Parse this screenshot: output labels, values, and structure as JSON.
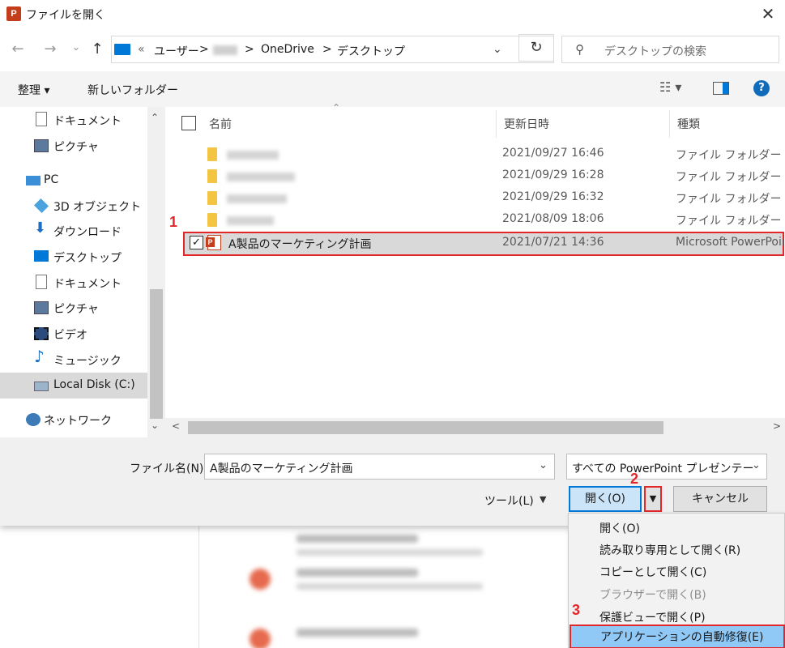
{
  "window": {
    "app_icon": "P",
    "title": "ファイルを開く",
    "close": "✕"
  },
  "nav": {
    "back": "←",
    "forward": "→",
    "recent": "⌄",
    "up": "↑",
    "address": {
      "sep_start": "«",
      "parts": [
        "ユーザー",
        "OneDrive",
        "デスクトップ"
      ],
      "sep": ">"
    },
    "refresh": "↻",
    "search_placeholder": "デスクトップの検索"
  },
  "toolbar": {
    "organize": "整理 ▾",
    "new_folder": "新しいフォルダー",
    "view": "☷ ▾",
    "help": "?"
  },
  "sidebar": {
    "items": [
      {
        "label": "ドキュメント",
        "icon": "document-icon"
      },
      {
        "label": "ピクチャ",
        "icon": "pictures-icon"
      },
      {
        "label": "PC",
        "icon": "pc-icon"
      },
      {
        "label": "3D オブジェクト",
        "icon": "3d-objects-icon"
      },
      {
        "label": "ダウンロード",
        "icon": "download-icon"
      },
      {
        "label": "デスクトップ",
        "icon": "desktop-icon"
      },
      {
        "label": "ドキュメント",
        "icon": "document-icon"
      },
      {
        "label": "ピクチャ",
        "icon": "pictures-icon"
      },
      {
        "label": "ビデオ",
        "icon": "video-icon"
      },
      {
        "label": "ミュージック",
        "icon": "music-icon"
      },
      {
        "label": "Local Disk (C:)",
        "icon": "disk-icon"
      },
      {
        "label": "ネットワーク",
        "icon": "network-icon"
      }
    ]
  },
  "columns": {
    "name": "名前",
    "modified": "更新日時",
    "type": "種類"
  },
  "files": [
    {
      "date": "2021/09/27 16:46",
      "type": "ファイル フォルダー"
    },
    {
      "date": "2021/09/29 16:28",
      "type": "ファイル フォルダー"
    },
    {
      "date": "2021/09/29 16:32",
      "type": "ファイル フォルダー"
    },
    {
      "date": "2021/08/09 18:06",
      "type": "ファイル フォルダー"
    },
    {
      "name": "A製品のマーケティング計画",
      "date": "2021/07/21 14:36",
      "type": "Microsoft PowerPoint"
    }
  ],
  "bottom": {
    "filename_label": "ファイル名(N):",
    "filename_value": "A製品のマーケティング計画",
    "filter_value": "すべての PowerPoint プレゼンテーション",
    "tools": "ツール(L)",
    "open": "開く(O)",
    "cancel": "キャンセル"
  },
  "menu": {
    "items": [
      "開く(O)",
      "読み取り専用として開く(R)",
      "コピーとして開く(C)",
      "ブラウザーで開く(B)",
      "保護ビューで開く(P)",
      "アプリケーションの自動修復(E)"
    ]
  },
  "annotations": [
    "1",
    "2",
    "3"
  ],
  "colors": {
    "accent": "#0078d7",
    "annotation": "#e2272b",
    "selection": "#d9d9d9",
    "menu_highlight": "#90c8f6"
  }
}
